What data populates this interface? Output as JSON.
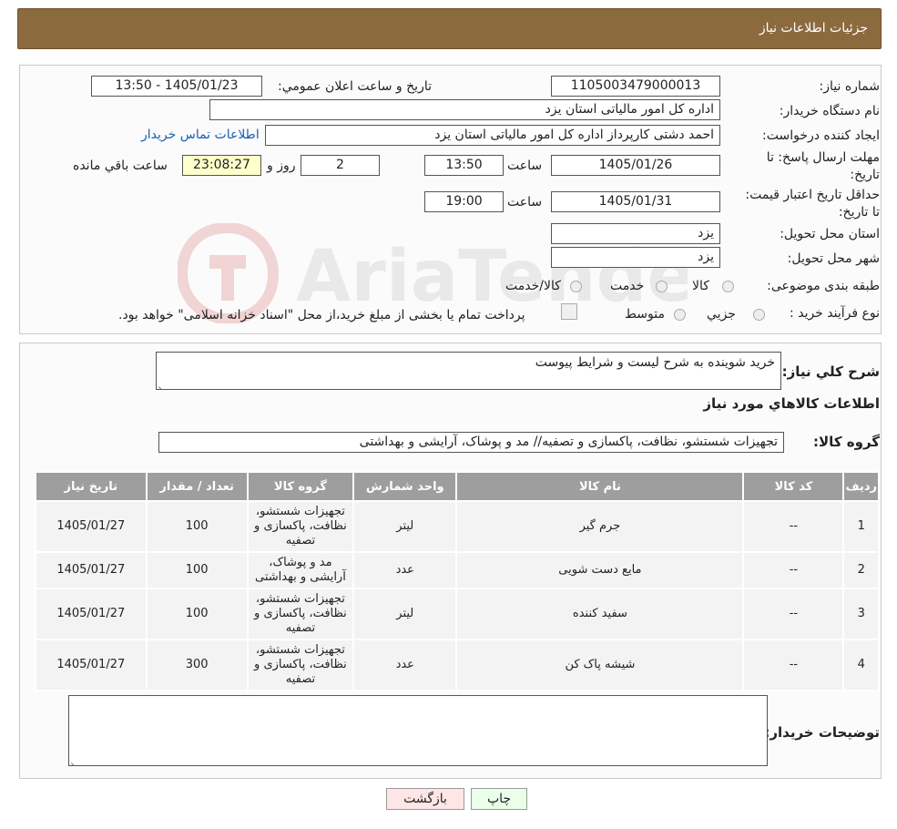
{
  "header": {
    "title": "جزئیات اطلاعات نیاز"
  },
  "form": {
    "need_number_label": "شماره نیاز:",
    "need_number": "1105003479000013",
    "announce_label": "تاریخ و ساعت اعلان عمومي:",
    "announce_value": "1405/01/23 - 13:50",
    "buyer_org_label": "نام دستگاه خریدار:",
    "buyer_org": "اداره کل امور مالیاتی استان یزد",
    "creator_label": "ایجاد کننده درخواست:",
    "creator": "احمد دشتی کارپرداز اداره کل امور مالیاتی استان یزد",
    "contact_link": "اطلاعات تماس خریدار",
    "deadline_label": "مهلت ارسال پاسخ: تا تاریخ:",
    "deadline_date": "1405/01/26",
    "time_label": "ساعت",
    "deadline_time": "13:50",
    "days": "2",
    "days_label": "روز و",
    "remaining": "23:08:27",
    "remaining_label": "ساعت باقي مانده",
    "validity_label": "حداقل تاریخ اعتبار قیمت: تا تاریخ:",
    "validity_date": "1405/01/31",
    "validity_time": "19:00",
    "province_label": "استان محل تحویل:",
    "province": "یزد",
    "city_label": "شهر محل تحویل:",
    "city": "یزد",
    "category_label": "طبقه بندی موضوعی:",
    "category_options": [
      "کالا",
      "خدمت",
      "کالا/خدمت"
    ],
    "process_label": "نوع فرآیند خرید :",
    "process_options": [
      "جزیي",
      "متوسط"
    ],
    "process_note": "پرداخت تمام یا بخشی از مبلغ خرید،از محل \"اسناد خزانه اسلامی\" خواهد بود."
  },
  "details": {
    "summary_label": "شرح کلي نیاز:",
    "summary": "خرید شوینده به شرح لیست و شرایط پیوست",
    "goods_heading": "اطلاعات کالاهاي مورد نیاز",
    "group_label": "گروه کالا:",
    "group_value": "تجهیزات شستشو، نظافت، پاکسازی و تصفیه// مد و پوشاک، آرایشی و بهداشتی"
  },
  "table": {
    "headers": [
      "ردیف",
      "کد کالا",
      "نام کالا",
      "واحد شمارش",
      "گروه کالا",
      "تعداد / مقدار",
      "تاریخ نیاز"
    ],
    "rows": [
      {
        "row": "1",
        "code": "--",
        "name": "جرم گیر",
        "unit": "لیتر",
        "group": "تجهیزات شستشو، نظافت، پاکسازی و تصفیه",
        "qty": "100",
        "date": "1405/01/27"
      },
      {
        "row": "2",
        "code": "--",
        "name": "مایع دست شویی",
        "unit": "عدد",
        "group": "مد و پوشاک، آرایشی و بهداشتی",
        "qty": "100",
        "date": "1405/01/27"
      },
      {
        "row": "3",
        "code": "--",
        "name": "سفید کننده",
        "unit": "لیتر",
        "group": "تجهیزات شستشو، نظافت، پاکسازی و تصفیه",
        "qty": "100",
        "date": "1405/01/27"
      },
      {
        "row": "4",
        "code": "--",
        "name": "شیشه پاک کن",
        "unit": "عدد",
        "group": "تجهیزات شستشو، نظافت، پاکسازی و تصفیه",
        "qty": "300",
        "date": "1405/01/27"
      }
    ]
  },
  "buyer_notes_label": "توضیحات خریدار:",
  "buttons": {
    "print": "چاپ",
    "back": "بازگشت"
  },
  "watermark": {
    "text": "AriaTender.neT"
  },
  "colors": {
    "header_bg": "#8b6a3e",
    "table_header_bg": "#9e9e9e",
    "print_bg": "#eaffea",
    "back_bg": "#ffe6e6"
  }
}
